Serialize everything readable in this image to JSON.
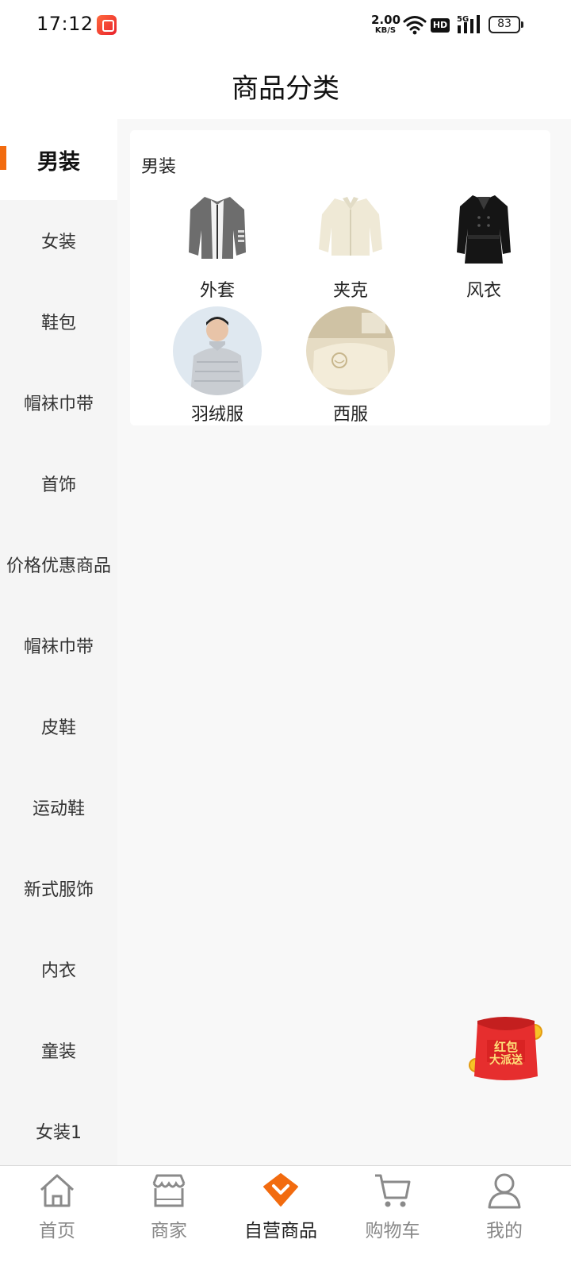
{
  "status_bar": {
    "time": "17:12",
    "net_speed_value": "2.00",
    "net_speed_unit": "KB/S",
    "hd_label": "HD",
    "signal_label": "5G",
    "battery": "83"
  },
  "header": {
    "title": "商品分类"
  },
  "sidebar": {
    "items": [
      {
        "label": "男装"
      },
      {
        "label": "女装"
      },
      {
        "label": "鞋包"
      },
      {
        "label": "帽袜巾带"
      },
      {
        "label": "首饰"
      },
      {
        "label": "价格优惠商品"
      },
      {
        "label": "帽袜巾带"
      },
      {
        "label": "皮鞋"
      },
      {
        "label": "运动鞋"
      },
      {
        "label": "新式服饰"
      },
      {
        "label": "内衣"
      },
      {
        "label": "童装"
      },
      {
        "label": "女装1"
      }
    ]
  },
  "category": {
    "title": "男装",
    "items": [
      {
        "label": "外套",
        "image": "grey-knit-jacket"
      },
      {
        "label": "夹克",
        "image": "cream-fleece-jacket"
      },
      {
        "label": "风衣",
        "image": "black-trench-coat"
      },
      {
        "label": "羽绒服",
        "image": "man-in-down-jacket"
      },
      {
        "label": "西服",
        "image": "pillow-bedding"
      }
    ]
  },
  "floating_badge": {
    "label": "红包大派送"
  },
  "tabbar": {
    "tabs": [
      {
        "label": "首页",
        "icon": "home-icon"
      },
      {
        "label": "商家",
        "icon": "store-icon"
      },
      {
        "label": "自营商品",
        "icon": "self-operated-icon"
      },
      {
        "label": "购物车",
        "icon": "cart-icon"
      },
      {
        "label": "我的",
        "icon": "profile-icon"
      }
    ],
    "active_index": 2
  },
  "colors": {
    "accent": "#f26b0f",
    "sidebar_bg": "#f5f5f5",
    "content_bg": "#f8f8f8"
  }
}
